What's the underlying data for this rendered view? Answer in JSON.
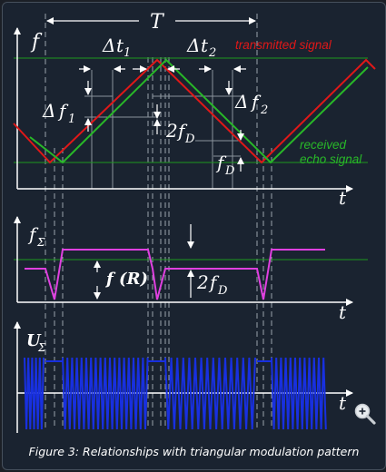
{
  "labels": {
    "T": "T",
    "f": "f",
    "t": "t",
    "delta": "Δ",
    "t1": "t",
    "t1_sub": "1",
    "t2": "t",
    "t2_sub": "2",
    "df1": "f",
    "df1_sub": "1",
    "df2": "f",
    "df2_sub": "2",
    "two": "2",
    "fD": "f",
    "fD_sub": "D",
    "fsum": "f",
    "fsum_sub": "Σ",
    "fR": "f (R)",
    "usum": "U",
    "usum_sub": "Σ",
    "transmitted": "transmitted signal",
    "received_1": "received",
    "received_2": "echo signal"
  },
  "caption": "Figure 3: Relationships with triangular modulation pattern",
  "colors": {
    "background": "#1a2330",
    "transmitted": "#e01818",
    "received": "#28b828",
    "difference": "#e040e0",
    "beat": "#1830e0",
    "axes": "#ffffff",
    "guides": "#8a939c"
  },
  "icons": {
    "zoom": "magnifier-zoom-icon"
  }
}
